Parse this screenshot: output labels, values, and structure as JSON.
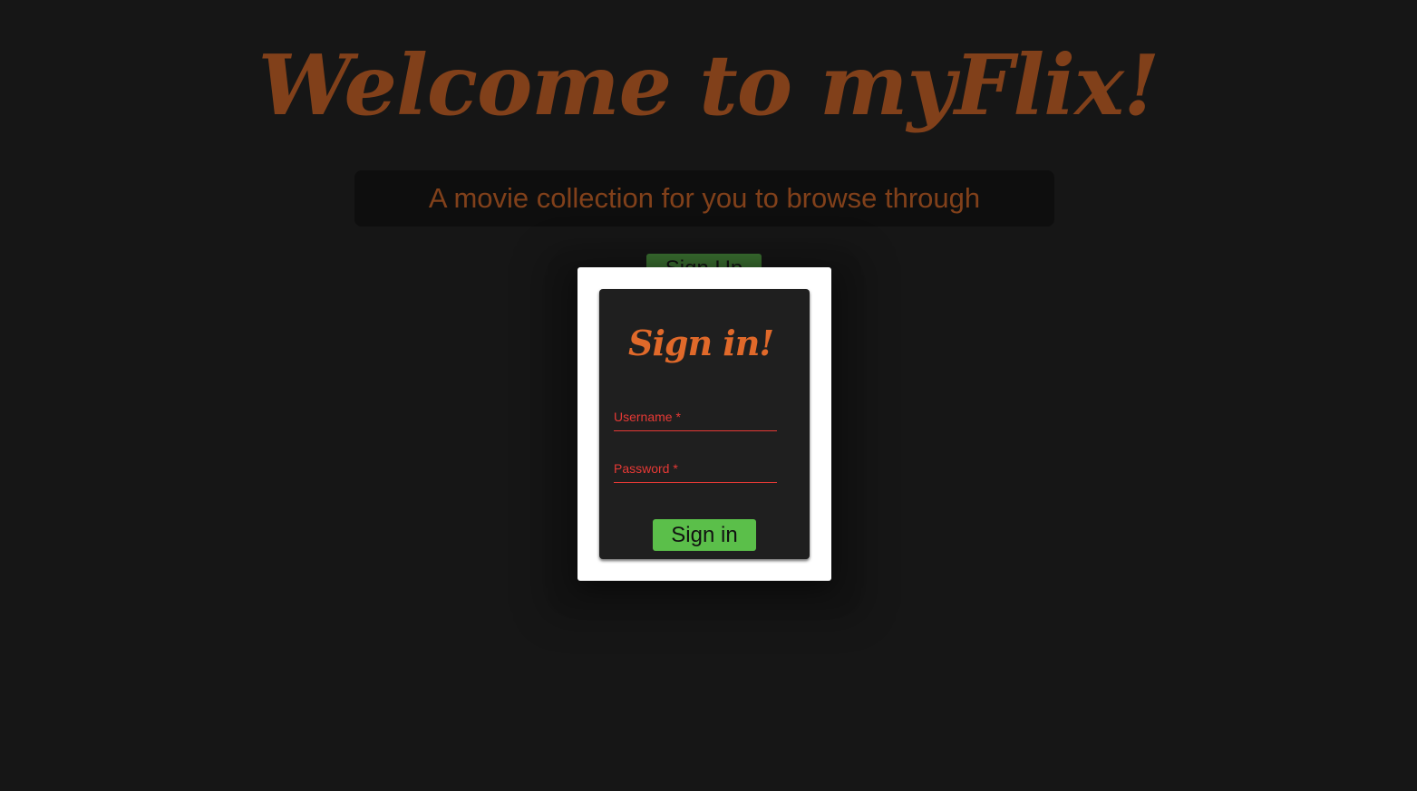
{
  "header": {
    "title": "Welcome to myFlix!",
    "tagline": "A movie collection for you to browse through"
  },
  "actions": {
    "signup_label": "Sign Up"
  },
  "login_modal": {
    "title": "Sign in!",
    "username_label": "Username *",
    "password_label": "Password *",
    "submit_label": "Sign in"
  },
  "colors": {
    "background": "#161616",
    "accent_orange": "#d9641e",
    "button_green": "#5bbf4a",
    "field_red": "#e53935",
    "card_bg": "#1f1f1f"
  }
}
